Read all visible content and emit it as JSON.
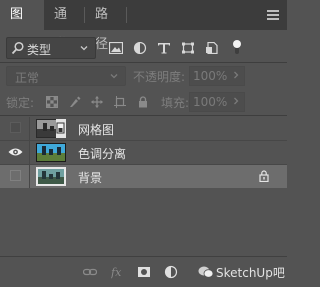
{
  "tabs": [
    {
      "label": "图层",
      "active": true
    },
    {
      "label": "通道",
      "active": false
    },
    {
      "label": "路径",
      "active": false
    }
  ],
  "filter": {
    "kind_label": "类型",
    "icons": [
      "image-filter-icon",
      "adjustment-filter-icon",
      "type-filter-icon",
      "shape-filter-icon",
      "smart-object-filter-icon",
      "filter-toggle-icon"
    ]
  },
  "blend": {
    "mode": "正常",
    "opacity_label": "不透明度:",
    "opacity_value": "100%"
  },
  "lock": {
    "label": "锁定:",
    "icons": [
      "lock-transparent-pixels-icon",
      "lock-image-pixels-icon",
      "lock-position-icon",
      "lock-artboard-icon",
      "lock-all-icon"
    ],
    "fill_label": "填充:",
    "fill_value": "100%"
  },
  "layers": [
    {
      "name": "网格图",
      "visible": false,
      "selected": false,
      "locked": false,
      "smart": true
    },
    {
      "name": "色调分离",
      "visible": true,
      "selected": false,
      "locked": false,
      "smart": false
    },
    {
      "name": "背景",
      "visible": false,
      "selected": true,
      "locked": true,
      "smart": false
    }
  ],
  "bottom_icons": [
    "link-layers-icon",
    "fx-icon",
    "mask-icon",
    "adjustment-layer-icon"
  ],
  "watermark": {
    "text": "SketchUp吧"
  },
  "colors": {
    "panel": "#535353",
    "tabbar": "#3c3c3c",
    "selected_row": "#6d6d6d",
    "text": "#e6e6e6"
  }
}
